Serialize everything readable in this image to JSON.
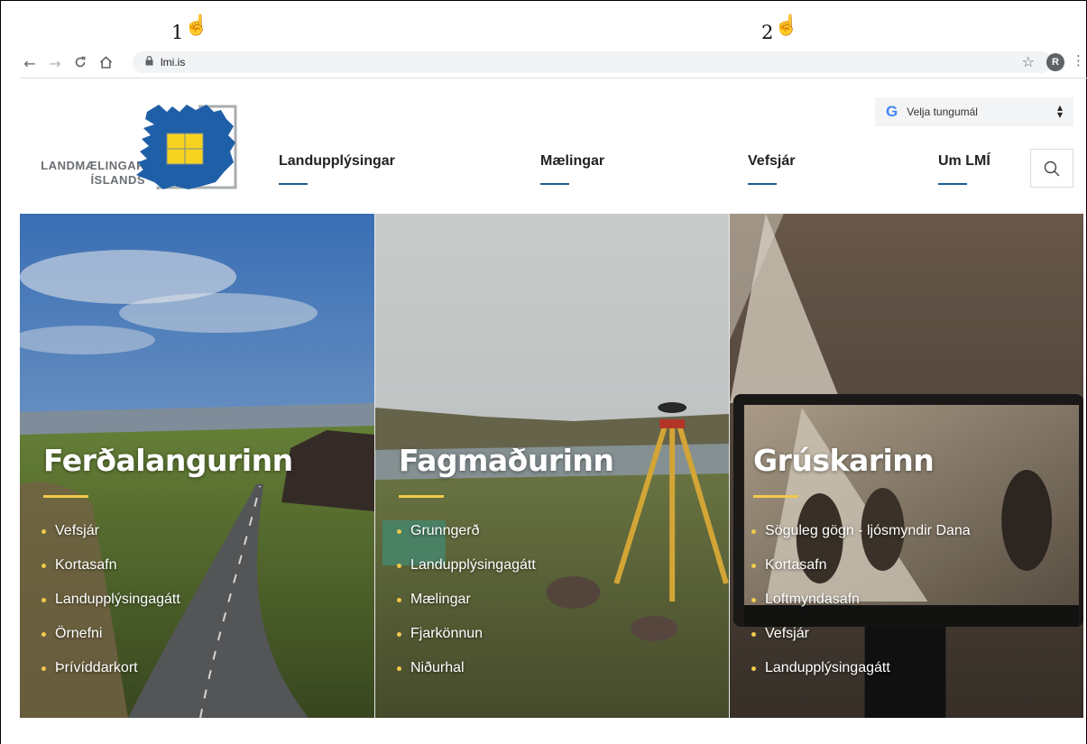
{
  "annotations": {
    "marker_1": "1",
    "marker_2": "2"
  },
  "browser": {
    "url": "lmi.is",
    "profile_initial": "R",
    "icons": [
      "back-arrow-icon",
      "forward-arrow-icon",
      "reload-icon",
      "home-icon",
      "lock-icon",
      "star-icon",
      "kebab-menu-icon"
    ]
  },
  "logo": {
    "line1": "LANDMÆLINGAR",
    "line2": "ÍSLANDS"
  },
  "nav": [
    {
      "label": "Landupplýsingar"
    },
    {
      "label": "Mælingar"
    },
    {
      "label": "Vefsjár"
    },
    {
      "label": "Um LMÍ"
    }
  ],
  "language": {
    "label": "Velja tungumál"
  },
  "panels": [
    {
      "title": "Ferðalangurinn",
      "items": [
        "Vefsjár",
        "Kortasafn",
        "Landupplýsingagátt",
        "Örnefni",
        "Þrívíddarkort"
      ]
    },
    {
      "title": "Fagmaðurinn",
      "items": [
        "Grunngerð",
        "Landupplýsingagátt",
        "Mælingar",
        "Fjarkönnun",
        "Niðurhal"
      ]
    },
    {
      "title": "Grúskarinn",
      "items": [
        "Söguleg gögn - ljósmyndir Dana",
        "Kortasafn",
        "Loftmyndasafn",
        "Vefsjár",
        "Landupplýsingagátt"
      ]
    }
  ],
  "colors": {
    "accent_blue": "#1a5d93",
    "accent_yellow": "#f2c94c",
    "logo_blue": "#1f5fa8",
    "logo_yellow": "#f6d320"
  }
}
